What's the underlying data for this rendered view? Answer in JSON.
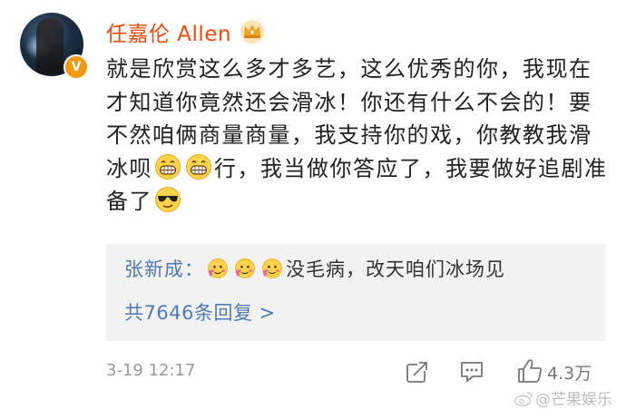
{
  "author": {
    "name": "任嘉伦 Allen",
    "verified_badge": "V",
    "icons": [
      "avatar",
      "crown-icon",
      "verified-badge"
    ]
  },
  "comment": {
    "part1": "就是欣赏这么多才多艺，这么优秀的你，我现在才知道你竟然还会滑冰！你还有什么不会的！要不然咱俩商量商量，我支持你的戏，你教教我滑冰呗",
    "part2": "行，我当做你答应了，我要做好追剧准备了",
    "emojis": [
      "grin-emoji",
      "grin-emoji",
      "sunglasses-emoji"
    ]
  },
  "reply": {
    "name": "张新成：",
    "text": "没毛病，改天咱们冰场见",
    "emojis": [
      "blush-emoji",
      "blush-emoji",
      "blush-emoji"
    ],
    "count_label": "共7646条回复 >"
  },
  "meta": {
    "time": "3-19 12:17",
    "like_count": "4.3万",
    "icons": [
      "share-icon",
      "comment-icon",
      "like-icon"
    ]
  },
  "watermark": {
    "text": "@芒果娱乐"
  },
  "colors": {
    "username": "#f04a0b",
    "link": "#4e7ab6",
    "reply_bg": "#f2f2f2",
    "meta": "#999999",
    "badge": "#f29b11"
  }
}
